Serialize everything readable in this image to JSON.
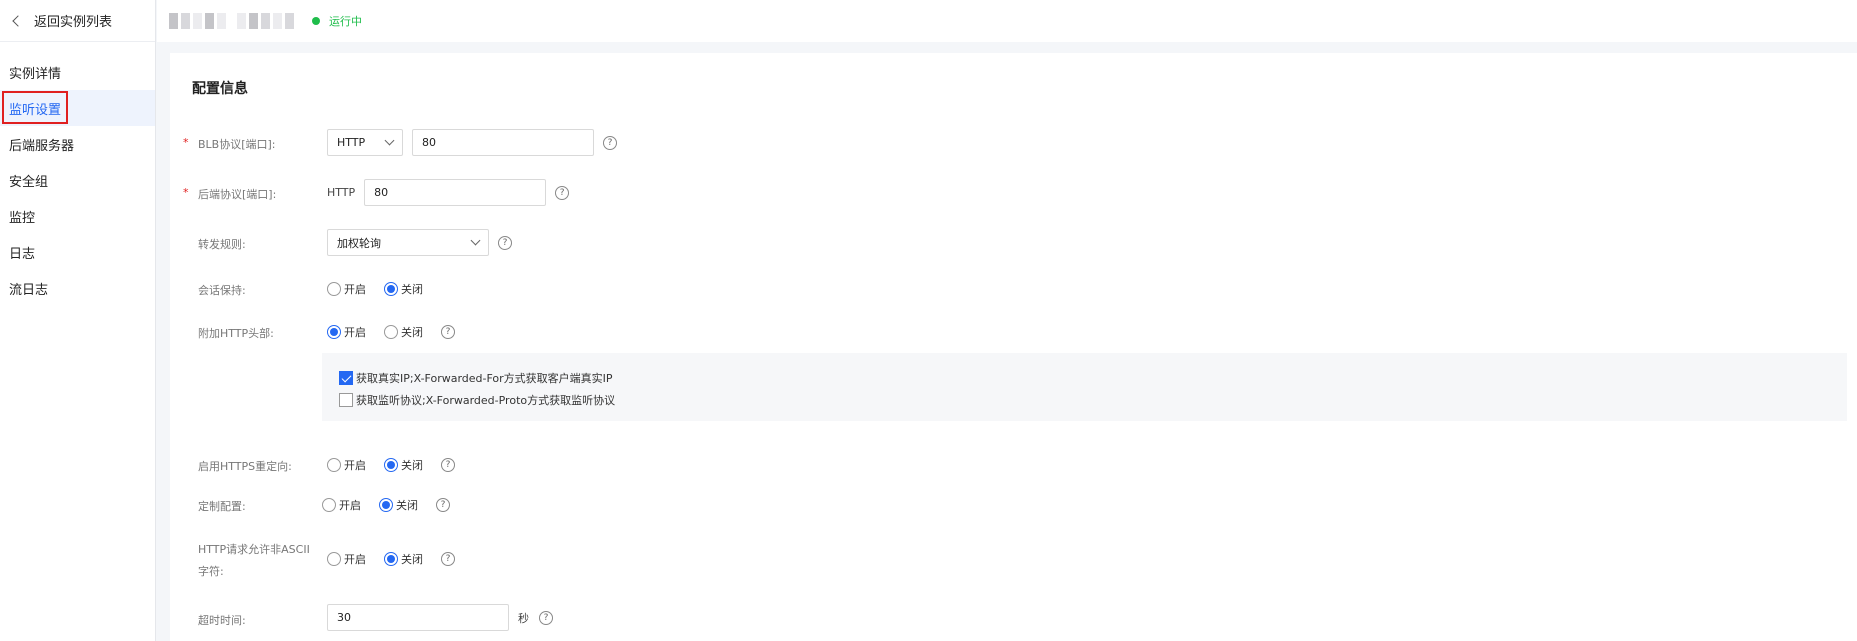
{
  "sidebar": {
    "back_label": "返回实例列表",
    "items": [
      {
        "label": "实例详情"
      },
      {
        "label": "监听设置"
      },
      {
        "label": "后端服务器"
      },
      {
        "label": "安全组"
      },
      {
        "label": "监控"
      },
      {
        "label": "日志"
      },
      {
        "label": "流日志"
      }
    ]
  },
  "header": {
    "status": "运行中",
    "status_color": "#1fbd4b"
  },
  "config": {
    "title": "配置信息",
    "blb_protocol": {
      "label": "BLB协议[端口]:",
      "protocol": "HTTP",
      "port": "80"
    },
    "backend_protocol": {
      "label": "后端协议[端口]:",
      "protocol": "HTTP",
      "port": "80"
    },
    "forward_rule": {
      "label": "转发规则:",
      "value": "加权轮询"
    },
    "session_keep": {
      "label": "会话保持:",
      "on": "开启",
      "off": "关闭",
      "selected": "off"
    },
    "http_header": {
      "label": "附加HTTP头部:",
      "on": "开启",
      "off": "关闭",
      "selected": "on"
    },
    "header_options": [
      {
        "label": "获取真实IP;X-Forwarded-For方式获取客户端真实IP",
        "checked": true
      },
      {
        "label": "获取监听协议;X-Forwarded-Proto方式获取监听协议",
        "checked": false
      }
    ],
    "https_redirect": {
      "label": "启用HTTPS重定向:",
      "on": "开启",
      "off": "关闭",
      "selected": "off"
    },
    "custom_config": {
      "label": "定制配置:",
      "on": "开启",
      "off": "关闭",
      "selected": "off"
    },
    "non_ascii": {
      "label_line1": "HTTP请求允许非ASCII",
      "label_line2": "字符:",
      "on": "开启",
      "off": "关闭",
      "selected": "off"
    },
    "timeout": {
      "label": "超时时间:",
      "value": "30",
      "unit": "秒"
    },
    "help_glyph": "?"
  },
  "colors": {
    "accent": "#2468f2",
    "required": "#e02020",
    "highlight_border": "#e02020"
  }
}
